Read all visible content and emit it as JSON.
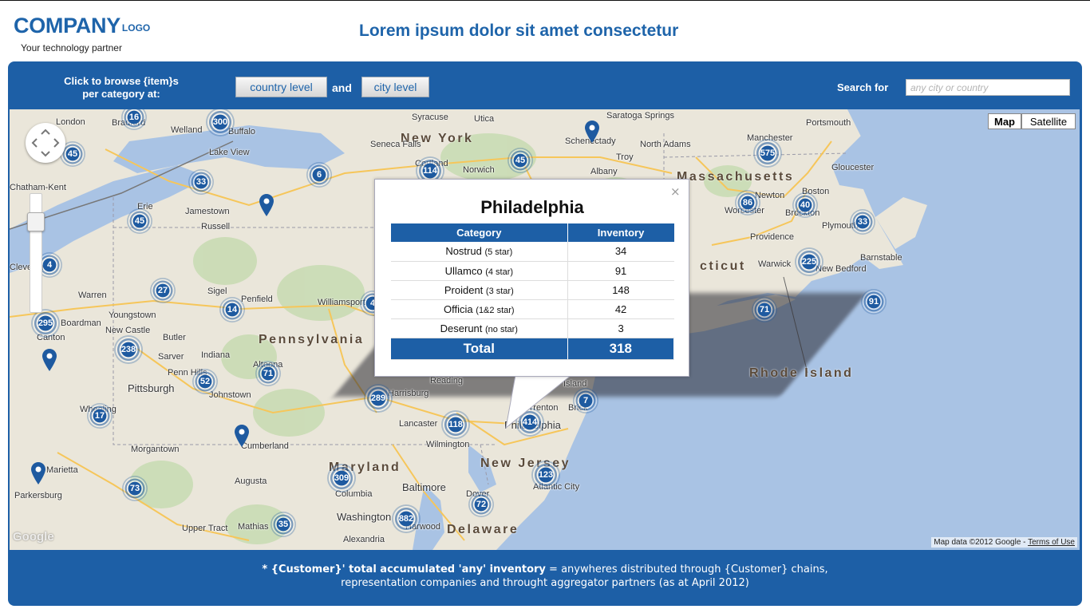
{
  "header": {
    "brand": "COMPANY",
    "brand_suffix": "LOGO",
    "tagline": "Your technology partner",
    "title": "Lorem ipsum dolor sit amet consectetur"
  },
  "toolbar": {
    "browse_label_line1": "Click to browse {item}s",
    "browse_label_line2": "per category at:",
    "country_level": "country level",
    "and": "and",
    "city_level": "city level",
    "search_label": "Search for",
    "search_placeholder": "any city or country"
  },
  "map": {
    "type_map": "Map",
    "type_satellite": "Satellite",
    "attribution": "Map data ©2012 Google - ",
    "terms": "Terms of Use",
    "google": "Google",
    "states": [
      "New York",
      "Massachusetts",
      "Pennsylvania",
      "Rhode Island",
      "Maryland",
      "New Jersey",
      "Delaware",
      "cticut"
    ],
    "cities": [
      "London",
      "Bradford",
      "Buffalo",
      "Welland",
      "Lake View",
      "Syracuse",
      "Utica",
      "Saratoga Springs",
      "Seneca Falls",
      "Schenectady",
      "Troy",
      "North Adams",
      "Albany",
      "Cortland",
      "Norwich",
      "Manchester",
      "Portsmouth",
      "Gloucester",
      "Boston",
      "Newton",
      "Worcester",
      "Brockton",
      "Plymouth",
      "Providence",
      "Warwick",
      "New Bedford",
      "Barnstable",
      "Chatham-Kent",
      "Erie",
      "Jamestown",
      "Russell",
      "Warren",
      "Youngstown",
      "Boardman",
      "New Castle",
      "Canton",
      "Butler",
      "Sarver",
      "Indiana",
      "Penn Hills",
      "Pittsburgh",
      "Johnstown",
      "Altoona",
      "Penfield",
      "Williamsport",
      "Sigel",
      "Wheeling",
      "Morgantown",
      "Cumberland",
      "Augusta",
      "Parkersburg",
      "Mathias",
      "Upper Tract",
      "Reading",
      "Lancaster",
      "Harrisburg",
      "Wilmington",
      "Philadelphia",
      "Trenton",
      "Brick",
      "Island",
      "Atlantic City",
      "Dover",
      "Baltimore",
      "Columbia",
      "Washington",
      "Harwood",
      "Alexandria",
      "Cleveland",
      "Marietta"
    ],
    "clusters": [
      "16",
      "300",
      "45",
      "33",
      "6",
      "114",
      "45",
      "575",
      "86",
      "40",
      "33",
      "45",
      "4",
      "27",
      "14",
      "295",
      "238",
      "52",
      "71",
      "289",
      "118",
      "414",
      "7",
      "17",
      "73",
      "309",
      "882",
      "35",
      "123",
      "72",
      "225",
      "91",
      "71",
      "4"
    ]
  },
  "popup": {
    "city": "Philadelphia",
    "close": "×",
    "col_category": "Category",
    "col_inventory": "Inventory",
    "rows": [
      {
        "name": "Nostrud",
        "rating": "(5 star)",
        "value": "34"
      },
      {
        "name": "Ullamco",
        "rating": "(4 star)",
        "value": "91"
      },
      {
        "name": "Proident",
        "rating": "(3 star)",
        "value": "148"
      },
      {
        "name": "Officia",
        "rating": "(1&2 star)",
        "value": "42"
      },
      {
        "name": "Deserunt",
        "rating": "(no star)",
        "value": "3"
      }
    ],
    "total_label": "Total",
    "total_value": "318"
  },
  "footer": {
    "bold": "* {Customer}' total accumulated 'any' inventory",
    "line1_rest": " = anywheres distributed through {Customer} chains,",
    "line2": "representation companies and throught aggregator partners (as at April 2012)"
  },
  "colors": {
    "brand_blue": "#1d5fa6",
    "marker_blue": "#1e5aa0",
    "water": "#a9c3e4",
    "land": "#eae6da"
  }
}
